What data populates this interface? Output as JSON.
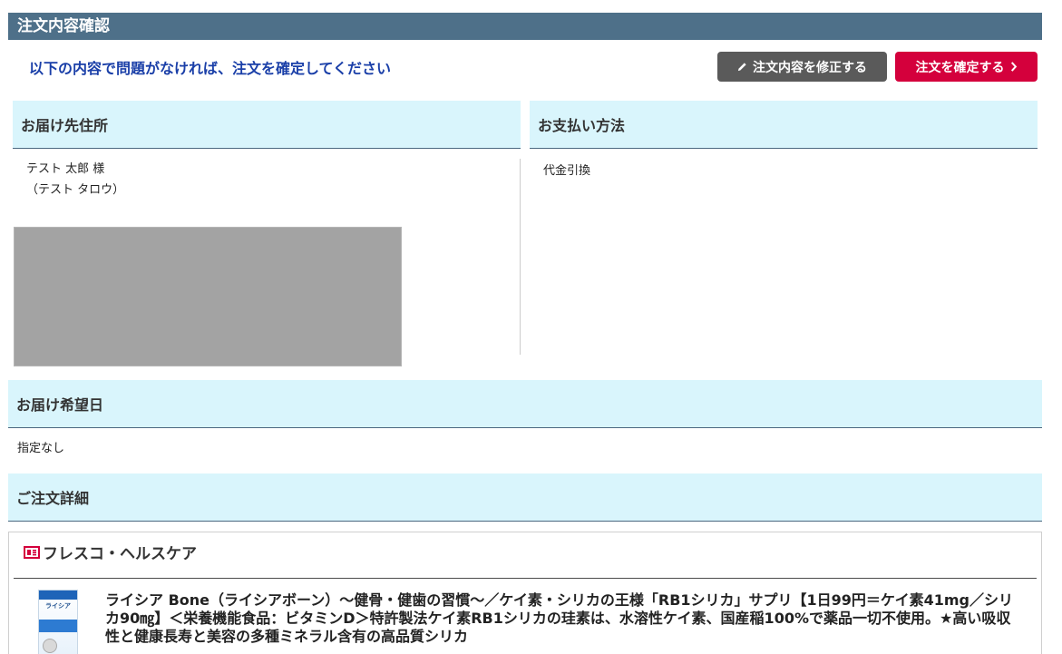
{
  "header": {
    "title": "注文内容確認"
  },
  "instruction": "以下の内容で問題がなければ、注文を確定してください",
  "buttons": {
    "edit_label": "注文内容を修正する",
    "confirm_label": "注文を確定する"
  },
  "address": {
    "heading": "お届け先住所",
    "name": "テスト 太郎 様",
    "kana": "（テスト タロウ）"
  },
  "payment": {
    "heading": "お支払い方法",
    "method": "代金引換"
  },
  "delivery": {
    "heading": "お届け希望日",
    "value": "指定なし"
  },
  "order_detail": {
    "heading": "ご注文詳細",
    "shop_name": "フレスコ・ヘルスケア",
    "product": {
      "image_text": "ライシア",
      "title": "ライシア Bone（ライシアボーン）〜健骨・健歯の習慣〜／ケイ素・シリカの王様「RB1シリカ」サプリ【1日99円＝ケイ素41mg／シリカ90㎎】＜栄養機能食品：ビタミンD＞特許製法ケイ素RB1シリカの珪素は、水溶性ケイ素、国産稲100%で薬品一切不使用。★高い吸収性と健康長寿と美容の多種ミネラル含有の高品質シリカ"
    }
  },
  "colors": {
    "title_bar": "#4e7089",
    "instruction_text": "#1a3fa8",
    "edit_button": "#5a5a5a",
    "confirm_button": "#d4003c",
    "section_head_bg": "#d9f5fc"
  }
}
